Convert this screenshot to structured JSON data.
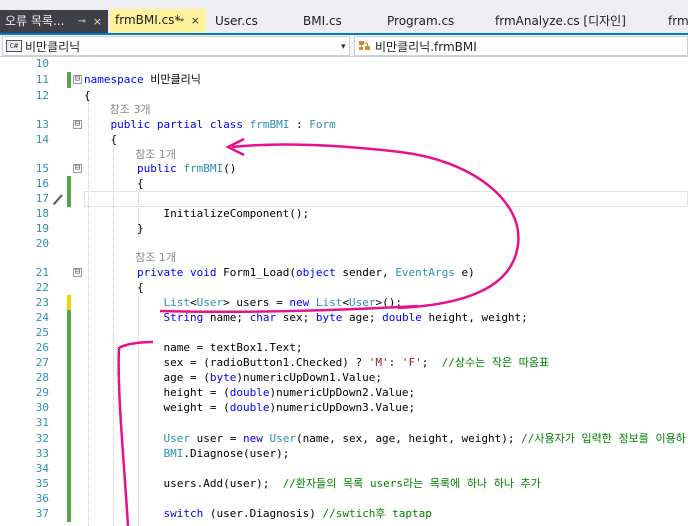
{
  "tabs": [
    {
      "label": "오류 목록...",
      "pin": "⊸",
      "close": "×",
      "style": "dark"
    },
    {
      "label": "frmBMI.cs*",
      "pin": "⊸",
      "close": "×",
      "style": "active"
    },
    {
      "label": "User.cs",
      "style": "plain"
    },
    {
      "label": "BMI.cs",
      "style": "plain"
    },
    {
      "label": "Program.cs",
      "style": "plain"
    },
    {
      "label": "frmAnalyze.cs [디자인]",
      "style": "plain"
    },
    {
      "label": "frm",
      "style": "plain"
    }
  ],
  "nav": {
    "left_icon": "C#",
    "left_label": "비만클리닉",
    "dropdown_arrow": "▾",
    "right_label": "비만클리닉.frmBMI"
  },
  "icons": {
    "file_type": "csharp-file-icon",
    "class": "class-icon",
    "pencil": "quick-action-pencil-icon",
    "fold_open": "⊟"
  },
  "colors": {
    "keyword": "#0000ff",
    "type": "#2b91af",
    "string": "#a31515",
    "comment": "#008000",
    "changed_saved": "#57a64a",
    "changed_unsaved": "#efd400",
    "annotation": "#e8108c",
    "active_tab": "#fff29d"
  },
  "code_lines": [
    {
      "kind": "code",
      "n": "10",
      "tokens": []
    },
    {
      "kind": "code",
      "n": "11",
      "change": "green",
      "fold": "⊟",
      "tokens": [
        {
          "t": "kw",
          "v": "namespace"
        },
        {
          "t": "pl",
          "v": " 비만클리닉"
        }
      ]
    },
    {
      "kind": "code",
      "n": "12",
      "tokens": [
        {
          "t": "pl",
          "v": "{"
        }
      ]
    },
    {
      "kind": "lens",
      "indent": 4,
      "text": "참조 3개"
    },
    {
      "kind": "code",
      "n": "13",
      "fold": "⊟",
      "tokens": [
        {
          "t": "pl",
          "v": "    "
        },
        {
          "t": "kw",
          "v": "public partial class"
        },
        {
          "t": "pl",
          "v": " "
        },
        {
          "t": "ty",
          "v": "frmBMI"
        },
        {
          "t": "pl",
          "v": " : "
        },
        {
          "t": "ty",
          "v": "Form"
        }
      ]
    },
    {
      "kind": "code",
      "n": "14",
      "tokens": [
        {
          "t": "pl",
          "v": "    {"
        }
      ]
    },
    {
      "kind": "lens",
      "indent": 8,
      "text": "참조 1개"
    },
    {
      "kind": "code",
      "n": "15",
      "fold": "⊟",
      "tokens": [
        {
          "t": "pl",
          "v": "        "
        },
        {
          "t": "kw",
          "v": "public"
        },
        {
          "t": "pl",
          "v": " "
        },
        {
          "t": "ty",
          "v": "frmBMI"
        },
        {
          "t": "pl",
          "v": "()"
        }
      ]
    },
    {
      "kind": "code",
      "n": "16",
      "change": "green",
      "tokens": [
        {
          "t": "pl",
          "v": "        {"
        }
      ]
    },
    {
      "kind": "code",
      "n": "17",
      "change": "green",
      "current": true,
      "pencil": true,
      "tokens": []
    },
    {
      "kind": "code",
      "n": "18",
      "tokens": [
        {
          "t": "pl",
          "v": "            InitializeComponent();"
        }
      ]
    },
    {
      "kind": "code",
      "n": "19",
      "tokens": [
        {
          "t": "pl",
          "v": "        }"
        }
      ]
    },
    {
      "kind": "code",
      "n": "20",
      "tokens": []
    },
    {
      "kind": "lens",
      "indent": 8,
      "text": "참조 1개"
    },
    {
      "kind": "code",
      "n": "21",
      "fold": "⊟",
      "tokens": [
        {
          "t": "pl",
          "v": "        "
        },
        {
          "t": "kw",
          "v": "private void"
        },
        {
          "t": "pl",
          "v": " Form1_Load("
        },
        {
          "t": "kw",
          "v": "object"
        },
        {
          "t": "pl",
          "v": " sender, "
        },
        {
          "t": "ty",
          "v": "EventArgs"
        },
        {
          "t": "pl",
          "v": " e)"
        }
      ]
    },
    {
      "kind": "code",
      "n": "22",
      "tokens": [
        {
          "t": "pl",
          "v": "        {"
        }
      ]
    },
    {
      "kind": "code",
      "n": "23",
      "change": "yellow",
      "tokens": [
        {
          "t": "pl",
          "v": "            "
        },
        {
          "t": "ty",
          "v": "List"
        },
        {
          "t": "pl",
          "v": "<"
        },
        {
          "t": "ty",
          "v": "User"
        },
        {
          "t": "pl",
          "v": "> users = "
        },
        {
          "t": "kw",
          "v": "new"
        },
        {
          "t": "pl",
          "v": " "
        },
        {
          "t": "ty",
          "v": "List"
        },
        {
          "t": "pl",
          "v": "<"
        },
        {
          "t": "ty",
          "v": "User"
        },
        {
          "t": "pl",
          "v": ">();"
        }
      ]
    },
    {
      "kind": "code",
      "n": "24",
      "change": "green",
      "tokens": [
        {
          "t": "pl",
          "v": "            "
        },
        {
          "t": "kw",
          "v": "String"
        },
        {
          "t": "pl",
          "v": " name; "
        },
        {
          "t": "kw",
          "v": "char"
        },
        {
          "t": "pl",
          "v": " sex; "
        },
        {
          "t": "kw",
          "v": "byte"
        },
        {
          "t": "pl",
          "v": " age; "
        },
        {
          "t": "kw",
          "v": "double"
        },
        {
          "t": "pl",
          "v": " height, weight;"
        }
      ]
    },
    {
      "kind": "code",
      "n": "25",
      "change": "green",
      "tokens": []
    },
    {
      "kind": "code",
      "n": "26",
      "change": "green",
      "tokens": [
        {
          "t": "pl",
          "v": "            name = textBox1.Text;"
        }
      ]
    },
    {
      "kind": "code",
      "n": "27",
      "change": "green",
      "tokens": [
        {
          "t": "pl",
          "v": "            sex = (radioButton1.Checked) ? "
        },
        {
          "t": "st",
          "v": "'M'"
        },
        {
          "t": "pl",
          "v": ": "
        },
        {
          "t": "st",
          "v": "'F'"
        },
        {
          "t": "pl",
          "v": ";  "
        },
        {
          "t": "cm",
          "v": "//상수는 작은 따옴표"
        }
      ]
    },
    {
      "kind": "code",
      "n": "28",
      "change": "green",
      "tokens": [
        {
          "t": "pl",
          "v": "            age = ("
        },
        {
          "t": "kw",
          "v": "byte"
        },
        {
          "t": "pl",
          "v": ")numericUpDown1.Value;"
        }
      ]
    },
    {
      "kind": "code",
      "n": "29",
      "change": "green",
      "tokens": [
        {
          "t": "pl",
          "v": "            height = ("
        },
        {
          "t": "kw",
          "v": "double"
        },
        {
          "t": "pl",
          "v": ")numericUpDown2.Value;"
        }
      ]
    },
    {
      "kind": "code",
      "n": "30",
      "change": "green",
      "tokens": [
        {
          "t": "pl",
          "v": "            weight = ("
        },
        {
          "t": "kw",
          "v": "double"
        },
        {
          "t": "pl",
          "v": ")numericUpDown3.Value;"
        }
      ]
    },
    {
      "kind": "code",
      "n": "31",
      "change": "green",
      "tokens": []
    },
    {
      "kind": "code",
      "n": "32",
      "change": "green",
      "tokens": [
        {
          "t": "pl",
          "v": "            "
        },
        {
          "t": "ty",
          "v": "User"
        },
        {
          "t": "pl",
          "v": " user = "
        },
        {
          "t": "kw",
          "v": "new"
        },
        {
          "t": "pl",
          "v": " "
        },
        {
          "t": "ty",
          "v": "User"
        },
        {
          "t": "pl",
          "v": "(name, sex, age, height, weight); "
        },
        {
          "t": "cm",
          "v": "//사용자가 입력한 정보를 이용하"
        }
      ]
    },
    {
      "kind": "code",
      "n": "33",
      "change": "green",
      "tokens": [
        {
          "t": "pl",
          "v": "            "
        },
        {
          "t": "ty",
          "v": "BMI"
        },
        {
          "t": "pl",
          "v": ".Diagnose(user);"
        }
      ]
    },
    {
      "kind": "code",
      "n": "34",
      "change": "green",
      "tokens": []
    },
    {
      "kind": "code",
      "n": "35",
      "change": "green",
      "tokens": [
        {
          "t": "pl",
          "v": "            users.Add(user);  "
        },
        {
          "t": "cm",
          "v": "//환자들의 목록 users라는 목록에 하나 하나 추가"
        }
      ]
    },
    {
      "kind": "code",
      "n": "36",
      "change": "green",
      "tokens": []
    },
    {
      "kind": "code",
      "n": "37",
      "change": "green",
      "tokens": [
        {
          "t": "pl",
          "v": "            "
        },
        {
          "t": "kw",
          "v": "switch"
        },
        {
          "t": "pl",
          "v": " (user.Diagnosis) "
        },
        {
          "t": "cm",
          "v": "//swtich후 taptap"
        }
      ]
    }
  ]
}
